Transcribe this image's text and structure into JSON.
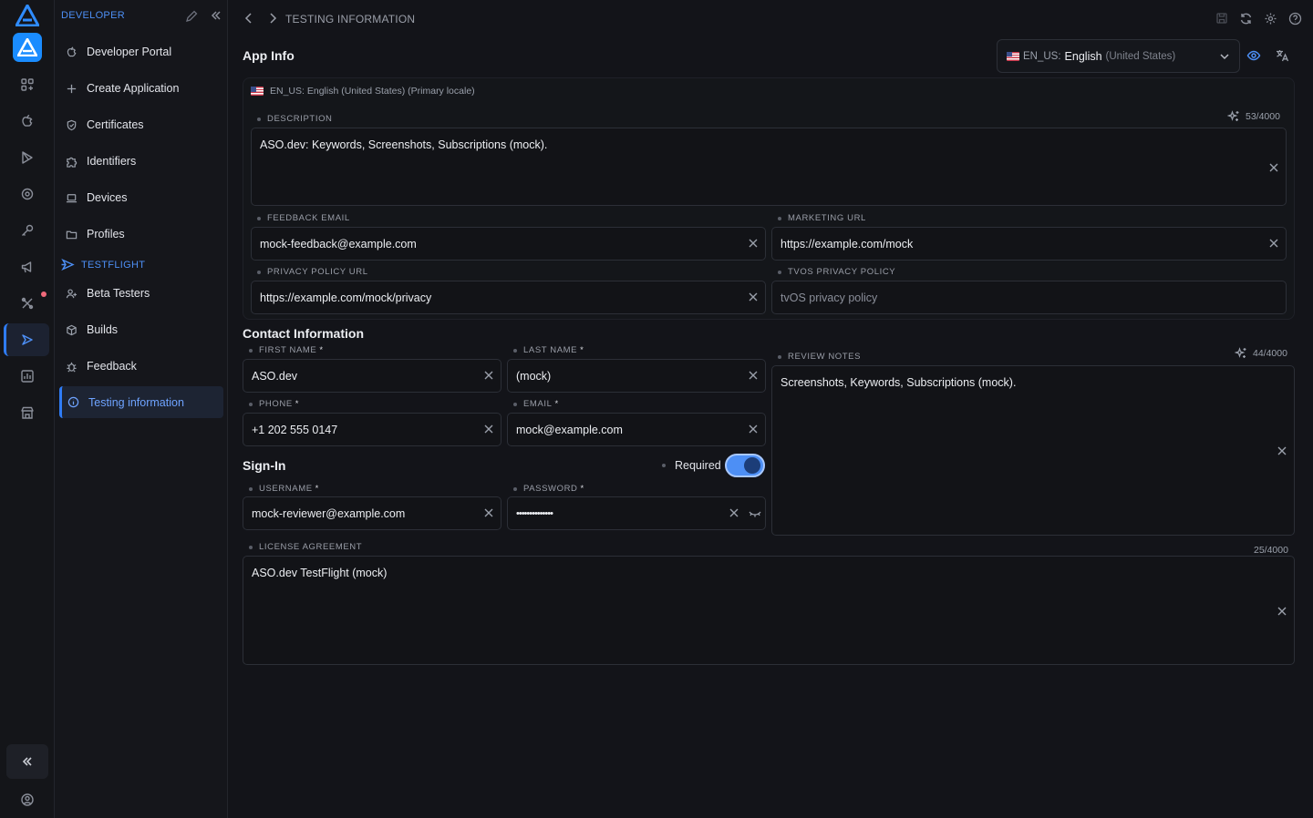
{
  "rail": {
    "icons": [
      "apps-icon",
      "apple-icon",
      "play-store-icon",
      "target-icon",
      "key-icon",
      "megaphone-icon",
      "tools-icon",
      "testflight-icon",
      "analytics-icon",
      "store-icon"
    ]
  },
  "sidebar": {
    "header": "DEVELOPER",
    "items": [
      {
        "label": "Developer Portal"
      },
      {
        "label": "Create Application"
      },
      {
        "label": "Certificates"
      },
      {
        "label": "Identifiers"
      },
      {
        "label": "Devices"
      },
      {
        "label": "Profiles"
      }
    ],
    "section": "TESTFLIGHT",
    "tf_items": [
      {
        "label": "Beta Testers"
      },
      {
        "label": "Builds"
      },
      {
        "label": "Feedback"
      },
      {
        "label": "Testing information"
      }
    ]
  },
  "topbar": {
    "breadcrumb": "TESTING INFORMATION"
  },
  "app_info": {
    "title": "App Info",
    "locale_code": "EN_US:",
    "locale_lang": "English",
    "locale_region": "(United States)",
    "primary_locale": "EN_US: English (United States) (Primary locale)",
    "description_label": "DESCRIPTION",
    "description_counter": "53/4000",
    "description": "ASO.dev: Keywords, Screenshots, Subscriptions (mock).",
    "feedback_email_label": "FEEDBACK EMAIL",
    "feedback_email": "mock-feedback@example.com",
    "marketing_url_label": "MARKETING URL",
    "marketing_url": "https://example.com/mock",
    "privacy_url_label": "PRIVACY POLICY URL",
    "privacy_url": "https://example.com/mock/privacy",
    "tvos_privacy_label": "TVOS PRIVACY POLICY",
    "tvos_privacy_placeholder": "tvOS privacy policy"
  },
  "contact": {
    "title": "Contact Information",
    "first_name_label": "FIRST NAME",
    "first_name": "ASO.dev",
    "last_name_label": "LAST NAME",
    "last_name": "(mock)",
    "phone_label": "PHONE",
    "phone": "+1 202 555 0147",
    "email_label": "EMAIL",
    "email": "mock@example.com",
    "required_mark": "*"
  },
  "review_notes": {
    "label": "REVIEW NOTES",
    "counter": "44/4000",
    "value": "Screenshots, Keywords, Subscriptions (mock)."
  },
  "signin": {
    "title": "Sign-In",
    "required_label": "Required",
    "required": true,
    "username_label": "USERNAME",
    "username": "mock-reviewer@example.com",
    "password_label": "PASSWORD",
    "password": "••••••••••••••"
  },
  "license": {
    "label": "LICENSE AGREEMENT",
    "counter": "25/4000",
    "value": "ASO.dev TestFlight (mock)"
  },
  "colors": {
    "accent": "#4d8ff5",
    "background": "#131419"
  }
}
